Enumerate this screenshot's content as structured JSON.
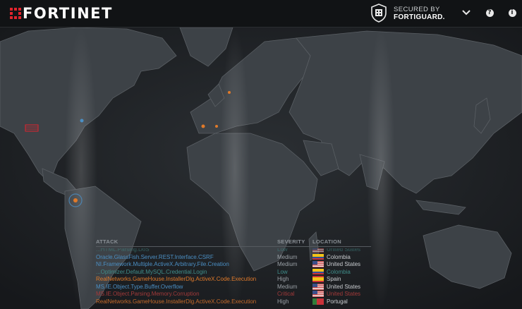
{
  "brand": {
    "name": "FORTINET",
    "accent": "#e1232c"
  },
  "secured": {
    "line1": "SECURED BY",
    "line2": "FORTIGUARD."
  },
  "nav": {
    "dropdown_icon": "chevron-down-icon",
    "help_icon": "help-icon",
    "help_glyph": "?",
    "info_icon": "info-icon",
    "info_glyph": "i"
  },
  "table": {
    "headers": {
      "attack": "ATTACK",
      "severity": "SEVERITY",
      "location": "LOCATION"
    },
    "rows": [
      {
        "attack": "Oracle.GlassFish.Server.REST.Interface.CSRF",
        "severity": "Medium",
        "location": "Colombia",
        "flag": "colombia",
        "color": "#4b8fc4",
        "sevColor": "#9aa0a6",
        "locColor": "#c9ccd0"
      },
      {
        "attack": "NI.Framework.Multiple.ActiveX.Arbitrary.File.Creation",
        "severity": "Medium",
        "location": "United States",
        "flag": "usa",
        "color": "#4b8fc4",
        "sevColor": "#9aa0a6",
        "locColor": "#c9ccd0"
      },
      {
        "attack": "...Optimizer.Default.MySQL.Credential.Login",
        "severity": "Low",
        "location": "Colombia",
        "flag": "colombia",
        "color": "#3f8e8a",
        "sevColor": "#3f8e8a",
        "locColor": "#3f8e8a"
      },
      {
        "attack": "RealNetworks.GameHouse.InstallerDlg.ActiveX.Code.Execution",
        "severity": "High",
        "location": "Spain",
        "flag": "spain",
        "color": "#e07a2a",
        "sevColor": "#9aa0a6",
        "locColor": "#c9ccd0"
      },
      {
        "attack": "MS.IE.Object.Type.Buffer.Overflow",
        "severity": "Medium",
        "location": "United States",
        "flag": "usa",
        "color": "#4b8fc4",
        "sevColor": "#9aa0a6",
        "locColor": "#c9ccd0"
      },
      {
        "attack": "MS.IE.Object.Parsing.Memory.Corruption",
        "severity": "Critical",
        "location": "United States",
        "flag": "usa",
        "color": "#a33a3a",
        "sevColor": "#a33a3a",
        "locColor": "#a33a3a"
      },
      {
        "attack": "RealNetworks.GameHouse.InstallerDlg.ActiveX.Code.Execution",
        "severity": "High",
        "location": "Portugal",
        "flag": "portugal",
        "color": "#c46a2a",
        "sevColor": "#9aa0a6",
        "locColor": "#c9ccd0"
      }
    ],
    "top_row": {
      "attack": "...HTML.Parsing.DoS",
      "severity": "Low",
      "location": "United States",
      "flag": "usa",
      "color": "#3f8e8a"
    }
  }
}
